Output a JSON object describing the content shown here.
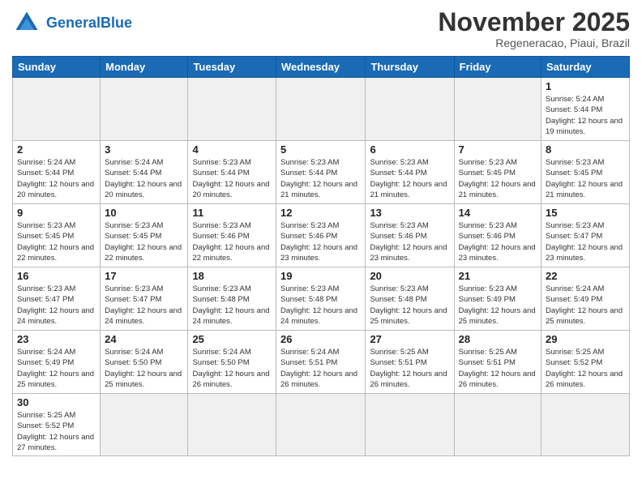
{
  "logo": {
    "text_general": "General",
    "text_blue": "Blue"
  },
  "header": {
    "month": "November 2025",
    "location": "Regeneracao, Piaui, Brazil"
  },
  "weekdays": [
    "Sunday",
    "Monday",
    "Tuesday",
    "Wednesday",
    "Thursday",
    "Friday",
    "Saturday"
  ],
  "days": {
    "1": "Sunrise: 5:24 AM\nSunset: 5:44 PM\nDaylight: 12 hours and 19 minutes.",
    "2": "Sunrise: 5:24 AM\nSunset: 5:44 PM\nDaylight: 12 hours and 20 minutes.",
    "3": "Sunrise: 5:24 AM\nSunset: 5:44 PM\nDaylight: 12 hours and 20 minutes.",
    "4": "Sunrise: 5:23 AM\nSunset: 5:44 PM\nDaylight: 12 hours and 20 minutes.",
    "5": "Sunrise: 5:23 AM\nSunset: 5:44 PM\nDaylight: 12 hours and 21 minutes.",
    "6": "Sunrise: 5:23 AM\nSunset: 5:44 PM\nDaylight: 12 hours and 21 minutes.",
    "7": "Sunrise: 5:23 AM\nSunset: 5:45 PM\nDaylight: 12 hours and 21 minutes.",
    "8": "Sunrise: 5:23 AM\nSunset: 5:45 PM\nDaylight: 12 hours and 21 minutes.",
    "9": "Sunrise: 5:23 AM\nSunset: 5:45 PM\nDaylight: 12 hours and 22 minutes.",
    "10": "Sunrise: 5:23 AM\nSunset: 5:45 PM\nDaylight: 12 hours and 22 minutes.",
    "11": "Sunrise: 5:23 AM\nSunset: 5:46 PM\nDaylight: 12 hours and 22 minutes.",
    "12": "Sunrise: 5:23 AM\nSunset: 5:46 PM\nDaylight: 12 hours and 23 minutes.",
    "13": "Sunrise: 5:23 AM\nSunset: 5:46 PM\nDaylight: 12 hours and 23 minutes.",
    "14": "Sunrise: 5:23 AM\nSunset: 5:46 PM\nDaylight: 12 hours and 23 minutes.",
    "15": "Sunrise: 5:23 AM\nSunset: 5:47 PM\nDaylight: 12 hours and 23 minutes.",
    "16": "Sunrise: 5:23 AM\nSunset: 5:47 PM\nDaylight: 12 hours and 24 minutes.",
    "17": "Sunrise: 5:23 AM\nSunset: 5:47 PM\nDaylight: 12 hours and 24 minutes.",
    "18": "Sunrise: 5:23 AM\nSunset: 5:48 PM\nDaylight: 12 hours and 24 minutes.",
    "19": "Sunrise: 5:23 AM\nSunset: 5:48 PM\nDaylight: 12 hours and 24 minutes.",
    "20": "Sunrise: 5:23 AM\nSunset: 5:48 PM\nDaylight: 12 hours and 25 minutes.",
    "21": "Sunrise: 5:23 AM\nSunset: 5:49 PM\nDaylight: 12 hours and 25 minutes.",
    "22": "Sunrise: 5:24 AM\nSunset: 5:49 PM\nDaylight: 12 hours and 25 minutes.",
    "23": "Sunrise: 5:24 AM\nSunset: 5:49 PM\nDaylight: 12 hours and 25 minutes.",
    "24": "Sunrise: 5:24 AM\nSunset: 5:50 PM\nDaylight: 12 hours and 25 minutes.",
    "25": "Sunrise: 5:24 AM\nSunset: 5:50 PM\nDaylight: 12 hours and 26 minutes.",
    "26": "Sunrise: 5:24 AM\nSunset: 5:51 PM\nDaylight: 12 hours and 26 minutes.",
    "27": "Sunrise: 5:25 AM\nSunset: 5:51 PM\nDaylight: 12 hours and 26 minutes.",
    "28": "Sunrise: 5:25 AM\nSunset: 5:51 PM\nDaylight: 12 hours and 26 minutes.",
    "29": "Sunrise: 5:25 AM\nSunset: 5:52 PM\nDaylight: 12 hours and 26 minutes.",
    "30": "Sunrise: 5:25 AM\nSunset: 5:52 PM\nDaylight: 12 hours and 27 minutes."
  }
}
